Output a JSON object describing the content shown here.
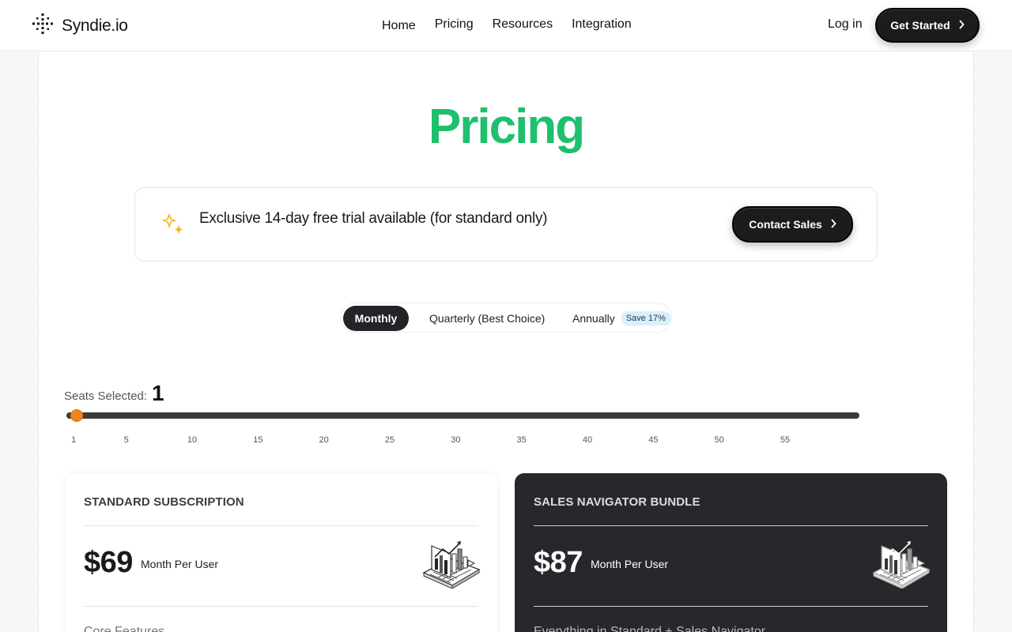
{
  "nav": {
    "brand": "Syndie.io",
    "links": [
      "Home",
      "Pricing",
      "Resources",
      "Integration"
    ],
    "login": "Log in",
    "cta": "Get Started"
  },
  "hero": {
    "title": "Pricing"
  },
  "trial": {
    "text": "Exclusive 14-day free trial available (for standard only)",
    "button": "Contact Sales"
  },
  "billing": {
    "options": [
      "Monthly",
      "Quarterly (Best Choice)",
      "Annually"
    ],
    "selected": "Monthly",
    "save_badge": "Save 17%"
  },
  "seats": {
    "label": "Seats Selected:",
    "value": "1",
    "min": 1,
    "max": 60,
    "ticks": [
      "1",
      "5",
      "10",
      "15",
      "20",
      "25",
      "30",
      "35",
      "40",
      "45",
      "50",
      "55"
    ]
  },
  "plans": [
    {
      "name": "STANDARD SUBSCRIPTION",
      "price": "$69",
      "period": "Month Per User",
      "features_heading": "Core Features"
    },
    {
      "name": "SALES NAVIGATOR BUNDLE",
      "price": "$87",
      "period": "Month Per User",
      "features_heading": "Everything in Standard + Sales Navigator"
    }
  ],
  "colors": {
    "title_green": "#1fbf6e",
    "slider_thumb": "#f2841c",
    "dark_card": "#26282c",
    "button_dark": "#1c1c1e"
  }
}
